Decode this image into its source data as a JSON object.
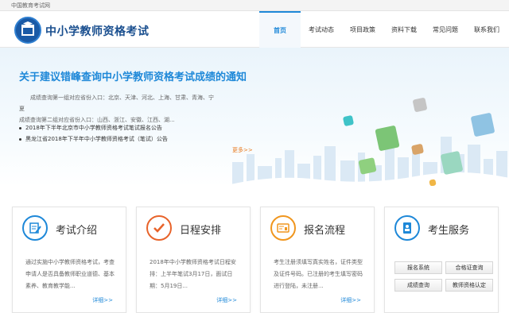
{
  "top_strip": {
    "site_link": "中国教育考试网"
  },
  "header": {
    "site_name": "中小学教师资格考试",
    "nav": [
      {
        "label": "首页",
        "active": true
      },
      {
        "label": "考试动态",
        "active": false
      },
      {
        "label": "项目政策",
        "active": false
      },
      {
        "label": "资料下载",
        "active": false
      },
      {
        "label": "常见问题",
        "active": false
      },
      {
        "label": "联系我们",
        "active": false
      }
    ]
  },
  "banner": {
    "title": "关于建议错峰查询中小学教师资格考试成绩的通知",
    "body_line1": "成绩查询第一组对应省份入口：北京、天津、河北、上海、甘肃、青海、宁夏",
    "body_line2": "成绩查询第二组对应省份入口：山西、浙江、安徽、江西、湖...",
    "news": [
      "2018年下半年北京市中小学教师资格考试笔试报名公告",
      "黑龙江省2018年下半年中小学教师资格考试（笔试）公告"
    ],
    "more": "更多>>"
  },
  "cards": [
    {
      "title": "考试介绍",
      "desc": "通过实施中小学教师资格考试，考查申请人是否具备教师职业道德、基本素养、教育教学能...",
      "detail": "详细>>",
      "icon": "document-pen-icon",
      "color": "#1e88d8"
    },
    {
      "title": "日程安排",
      "desc": "2018年中小学教师资格考试日程安排：上半年笔试3月17日，面试日期：5月19日...",
      "detail": "详细>>",
      "icon": "checkmark-icon",
      "color": "#e8632a"
    },
    {
      "title": "报名流程",
      "desc": "考生注册须填写真实姓名，证件类型及证件号码。已注册的考生填写密码进行登陆，未注册...",
      "detail": "详细>>",
      "icon": "form-icon",
      "color": "#f0961e"
    },
    {
      "title": "考生服务",
      "icon": "person-card-icon",
      "color": "#1e88d8",
      "services": [
        "报名系统",
        "合格证查询",
        "成绩查询",
        "教师资格认定"
      ]
    }
  ]
}
